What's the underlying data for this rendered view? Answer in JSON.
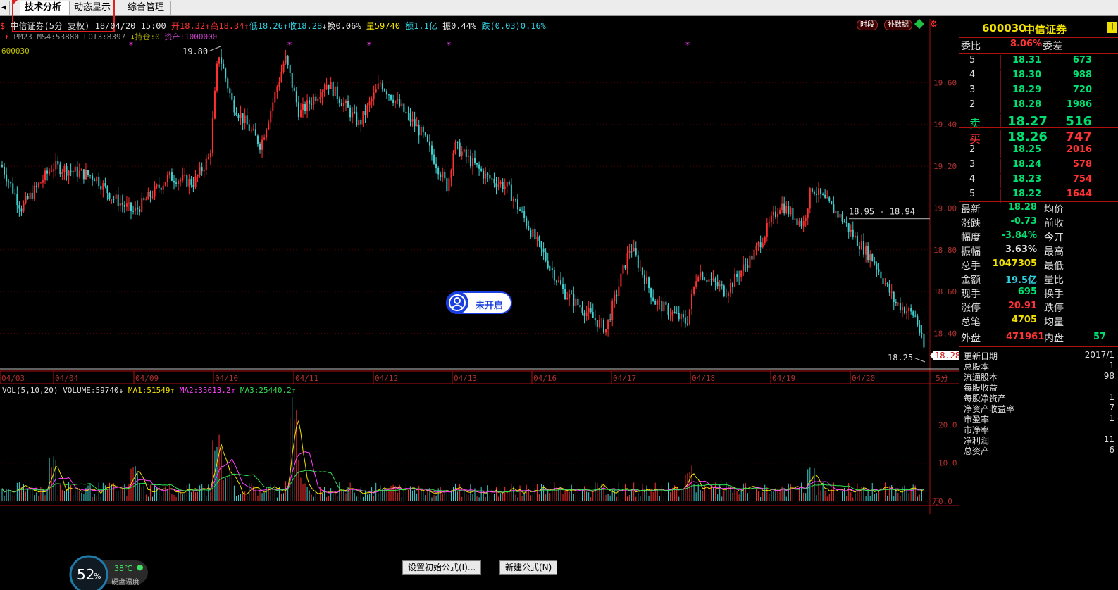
{
  "tabs": [
    "技术分析",
    "动态显示牌",
    "综合管理"
  ],
  "header": {
    "stock_name": "中信证券(5分 复权)",
    "date": "18/04/20 15:00",
    "open": "开18.32",
    "high": "高18.34",
    "low": "低18.26",
    "close": "收18.28",
    "turnover": "换0.06%",
    "volume": "量59740",
    "amount": "额1.1亿",
    "amplitude": "振0.44%",
    "change": "跌(0.03)0.16%",
    "line2": "PM23 MS4:53880 LOT3:8397",
    "position": "持仓:0",
    "assets": "资产:1000000",
    "btn_period": "时段",
    "btn_data": "补数据",
    "code": "600030"
  },
  "overlay": {
    "badge_text": "未开启",
    "high_label": "19.80",
    "low_label": "18.25",
    "line_label": "18.95 - 18.94",
    "last_price_tag": "18.28"
  },
  "chart_data": [
    {
      "type": "candlestick",
      "period": "5分",
      "x_ticks": [
        "04/03",
        "04/04",
        "04/09",
        "04/10",
        "04/11",
        "04/12",
        "04/13",
        "04/16",
        "04/17",
        "04/18",
        "04/19",
        "04/20"
      ],
      "y_ticks": [
        "19.60",
        "19.40",
        "19.20",
        "19.00",
        "18.80",
        "18.60",
        "18.40"
      ],
      "ylim": [
        18.25,
        19.8
      ],
      "anchors": [
        {
          "x": 0,
          "y": 19.22
        },
        {
          "x": 30,
          "y": 19.0
        },
        {
          "x": 75,
          "y": 19.2
        },
        {
          "x": 135,
          "y": 19.15
        },
        {
          "x": 160,
          "y": 19.05
        },
        {
          "x": 190,
          "y": 18.98
        },
        {
          "x": 240,
          "y": 19.15
        },
        {
          "x": 275,
          "y": 19.12
        },
        {
          "x": 298,
          "y": 19.25
        },
        {
          "x": 310,
          "y": 19.75
        },
        {
          "x": 330,
          "y": 19.5
        },
        {
          "x": 370,
          "y": 19.3
        },
        {
          "x": 405,
          "y": 19.72
        },
        {
          "x": 425,
          "y": 19.45
        },
        {
          "x": 465,
          "y": 19.6
        },
        {
          "x": 510,
          "y": 19.4
        },
        {
          "x": 540,
          "y": 19.6
        },
        {
          "x": 600,
          "y": 19.35
        },
        {
          "x": 635,
          "y": 19.1
        },
        {
          "x": 645,
          "y": 19.3
        },
        {
          "x": 690,
          "y": 19.15
        },
        {
          "x": 720,
          "y": 19.1
        },
        {
          "x": 760,
          "y": 18.85
        },
        {
          "x": 800,
          "y": 18.6
        },
        {
          "x": 860,
          "y": 18.42
        },
        {
          "x": 895,
          "y": 18.82
        },
        {
          "x": 930,
          "y": 18.55
        },
        {
          "x": 975,
          "y": 18.45
        },
        {
          "x": 990,
          "y": 18.7
        },
        {
          "x": 1030,
          "y": 18.6
        },
        {
          "x": 1070,
          "y": 18.78
        },
        {
          "x": 1108,
          "y": 19.02
        },
        {
          "x": 1140,
          "y": 18.92
        },
        {
          "x": 1152,
          "y": 19.1
        },
        {
          "x": 1195,
          "y": 18.95
        },
        {
          "x": 1215,
          "y": 18.85
        },
        {
          "x": 1240,
          "y": 18.75
        },
        {
          "x": 1270,
          "y": 18.55
        },
        {
          "x": 1300,
          "y": 18.48
        },
        {
          "x": 1315,
          "y": 18.28
        }
      ]
    },
    {
      "type": "bar",
      "title": "VOL(5,10,20)",
      "series": [
        {
          "name": "VOLUME",
          "value": "59740",
          "color": "#30d0e0"
        },
        {
          "name": "MA1",
          "value": "51549",
          "color": "#f0e000"
        },
        {
          "name": "MA2",
          "value": "35613.2",
          "color": "#ff40ff"
        },
        {
          "name": "MA3",
          "value": "25440.2",
          "color": "#30e050"
        }
      ],
      "y_ticks": [
        "20.0",
        "10.0",
        "0.0"
      ],
      "unit": "万",
      "ylim": [
        0,
        28
      ]
    }
  ],
  "quote": {
    "code": "600030",
    "name": "中信证券",
    "weibi_label": "委比",
    "weibi": "8.06%",
    "weicha_label": "委差",
    "sell": [
      {
        "lv": "5",
        "price": "18.31",
        "vol": "673"
      },
      {
        "lv": "4",
        "price": "18.30",
        "vol": "988"
      },
      {
        "lv": "3",
        "price": "18.29",
        "vol": "720"
      },
      {
        "lv": "2",
        "price": "18.28",
        "vol": "1986"
      },
      {
        "lv": "卖",
        "price": "18.27",
        "vol": "516"
      }
    ],
    "buy": [
      {
        "lv": "买",
        "price": "18.26",
        "vol": "747"
      },
      {
        "lv": "2",
        "price": "18.25",
        "vol": "2016"
      },
      {
        "lv": "3",
        "price": "18.24",
        "vol": "578"
      },
      {
        "lv": "4",
        "price": "18.23",
        "vol": "754"
      },
      {
        "lv": "5",
        "price": "18.22",
        "vol": "1644"
      }
    ],
    "stats": [
      {
        "l": "最新",
        "v": "18.28",
        "c": "dn",
        "r": "均价"
      },
      {
        "l": "涨跌",
        "v": "-0.73",
        "c": "dn",
        "r": "前收"
      },
      {
        "l": "幅度",
        "v": "-3.84%",
        "c": "dn",
        "r": "今开"
      },
      {
        "l": "振幅",
        "v": "3.63%",
        "c": "wt",
        "r": "最高"
      },
      {
        "l": "总手",
        "v": "1047305",
        "c": "yw",
        "r": "最低"
      },
      {
        "l": "金额",
        "v": "19.5亿",
        "c": "cy",
        "r": "量比"
      },
      {
        "l": "现手",
        "v": "695",
        "c": "dn",
        "r": "换手"
      },
      {
        "l": "涨停",
        "v": "20.91",
        "c": "up",
        "r": "跌停"
      },
      {
        "l": "总笔",
        "v": "4705",
        "c": "yw",
        "r": "均量"
      }
    ],
    "outer_label": "外盘",
    "outer": "471961",
    "inner_label": "内盘",
    "inner": "57",
    "fin_labels": [
      "更新日期",
      "总股本",
      "流通股本",
      "每股收益",
      "每股净资产",
      "净资产收益率",
      "市盈率",
      "市净率",
      "净利润",
      "总资产"
    ],
    "fin_values": [
      "2017/1",
      "1",
      "98",
      "",
      "1",
      "7",
      "1",
      "",
      "11",
      "6"
    ]
  },
  "buttons": {
    "init_formula": "设置初始公式(I)...",
    "new_formula": "新建公式(N)"
  },
  "system": {
    "cpu_pct": "52",
    "pct_sign": "%",
    "temp": "38℃",
    "temp_label": "硬盘温度"
  }
}
